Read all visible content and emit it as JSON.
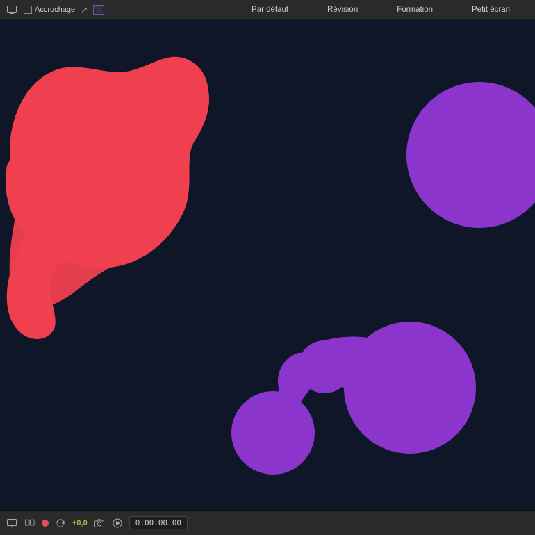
{
  "toolbar": {
    "snap_label": "Accrochage",
    "workspace": {
      "default_label": "Par défaut",
      "revision_label": "Révision",
      "formation_label": "Formation",
      "petit_ecran_label": "Petit écran"
    }
  },
  "bottom": {
    "timecode": "0:00:00:00",
    "counter": "+0,0"
  },
  "canvas": {
    "bg_color": "#0e1628",
    "blob_red_color": "#f04050",
    "blob_purple_color": "#8b35cc"
  }
}
